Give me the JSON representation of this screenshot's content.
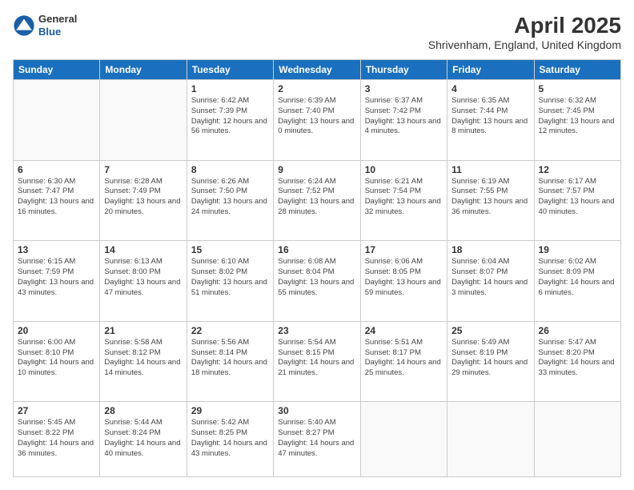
{
  "logo": {
    "general": "General",
    "blue": "Blue"
  },
  "title": "April 2025",
  "subtitle": "Shrivenham, England, United Kingdom",
  "headers": [
    "Sunday",
    "Monday",
    "Tuesday",
    "Wednesday",
    "Thursday",
    "Friday",
    "Saturday"
  ],
  "weeks": [
    [
      {
        "num": "",
        "info": ""
      },
      {
        "num": "",
        "info": ""
      },
      {
        "num": "1",
        "info": "Sunrise: 6:42 AM\nSunset: 7:39 PM\nDaylight: 12 hours\nand 56 minutes."
      },
      {
        "num": "2",
        "info": "Sunrise: 6:39 AM\nSunset: 7:40 PM\nDaylight: 13 hours\nand 0 minutes."
      },
      {
        "num": "3",
        "info": "Sunrise: 6:37 AM\nSunset: 7:42 PM\nDaylight: 13 hours\nand 4 minutes."
      },
      {
        "num": "4",
        "info": "Sunrise: 6:35 AM\nSunset: 7:44 PM\nDaylight: 13 hours\nand 8 minutes."
      },
      {
        "num": "5",
        "info": "Sunrise: 6:32 AM\nSunset: 7:45 PM\nDaylight: 13 hours\nand 12 minutes."
      }
    ],
    [
      {
        "num": "6",
        "info": "Sunrise: 6:30 AM\nSunset: 7:47 PM\nDaylight: 13 hours\nand 16 minutes."
      },
      {
        "num": "7",
        "info": "Sunrise: 6:28 AM\nSunset: 7:49 PM\nDaylight: 13 hours\nand 20 minutes."
      },
      {
        "num": "8",
        "info": "Sunrise: 6:26 AM\nSunset: 7:50 PM\nDaylight: 13 hours\nand 24 minutes."
      },
      {
        "num": "9",
        "info": "Sunrise: 6:24 AM\nSunset: 7:52 PM\nDaylight: 13 hours\nand 28 minutes."
      },
      {
        "num": "10",
        "info": "Sunrise: 6:21 AM\nSunset: 7:54 PM\nDaylight: 13 hours\nand 32 minutes."
      },
      {
        "num": "11",
        "info": "Sunrise: 6:19 AM\nSunset: 7:55 PM\nDaylight: 13 hours\nand 36 minutes."
      },
      {
        "num": "12",
        "info": "Sunrise: 6:17 AM\nSunset: 7:57 PM\nDaylight: 13 hours\nand 40 minutes."
      }
    ],
    [
      {
        "num": "13",
        "info": "Sunrise: 6:15 AM\nSunset: 7:59 PM\nDaylight: 13 hours\nand 43 minutes."
      },
      {
        "num": "14",
        "info": "Sunrise: 6:13 AM\nSunset: 8:00 PM\nDaylight: 13 hours\nand 47 minutes."
      },
      {
        "num": "15",
        "info": "Sunrise: 6:10 AM\nSunset: 8:02 PM\nDaylight: 13 hours\nand 51 minutes."
      },
      {
        "num": "16",
        "info": "Sunrise: 6:08 AM\nSunset: 8:04 PM\nDaylight: 13 hours\nand 55 minutes."
      },
      {
        "num": "17",
        "info": "Sunrise: 6:06 AM\nSunset: 8:05 PM\nDaylight: 13 hours\nand 59 minutes."
      },
      {
        "num": "18",
        "info": "Sunrise: 6:04 AM\nSunset: 8:07 PM\nDaylight: 14 hours\nand 3 minutes."
      },
      {
        "num": "19",
        "info": "Sunrise: 6:02 AM\nSunset: 8:09 PM\nDaylight: 14 hours\nand 6 minutes."
      }
    ],
    [
      {
        "num": "20",
        "info": "Sunrise: 6:00 AM\nSunset: 8:10 PM\nDaylight: 14 hours\nand 10 minutes."
      },
      {
        "num": "21",
        "info": "Sunrise: 5:58 AM\nSunset: 8:12 PM\nDaylight: 14 hours\nand 14 minutes."
      },
      {
        "num": "22",
        "info": "Sunrise: 5:56 AM\nSunset: 8:14 PM\nDaylight: 14 hours\nand 18 minutes."
      },
      {
        "num": "23",
        "info": "Sunrise: 5:54 AM\nSunset: 8:15 PM\nDaylight: 14 hours\nand 21 minutes."
      },
      {
        "num": "24",
        "info": "Sunrise: 5:51 AM\nSunset: 8:17 PM\nDaylight: 14 hours\nand 25 minutes."
      },
      {
        "num": "25",
        "info": "Sunrise: 5:49 AM\nSunset: 8:19 PM\nDaylight: 14 hours\nand 29 minutes."
      },
      {
        "num": "26",
        "info": "Sunrise: 5:47 AM\nSunset: 8:20 PM\nDaylight: 14 hours\nand 33 minutes."
      }
    ],
    [
      {
        "num": "27",
        "info": "Sunrise: 5:45 AM\nSunset: 8:22 PM\nDaylight: 14 hours\nand 36 minutes."
      },
      {
        "num": "28",
        "info": "Sunrise: 5:44 AM\nSunset: 8:24 PM\nDaylight: 14 hours\nand 40 minutes."
      },
      {
        "num": "29",
        "info": "Sunrise: 5:42 AM\nSunset: 8:25 PM\nDaylight: 14 hours\nand 43 minutes."
      },
      {
        "num": "30",
        "info": "Sunrise: 5:40 AM\nSunset: 8:27 PM\nDaylight: 14 hours\nand 47 minutes."
      },
      {
        "num": "",
        "info": ""
      },
      {
        "num": "",
        "info": ""
      },
      {
        "num": "",
        "info": ""
      }
    ]
  ]
}
